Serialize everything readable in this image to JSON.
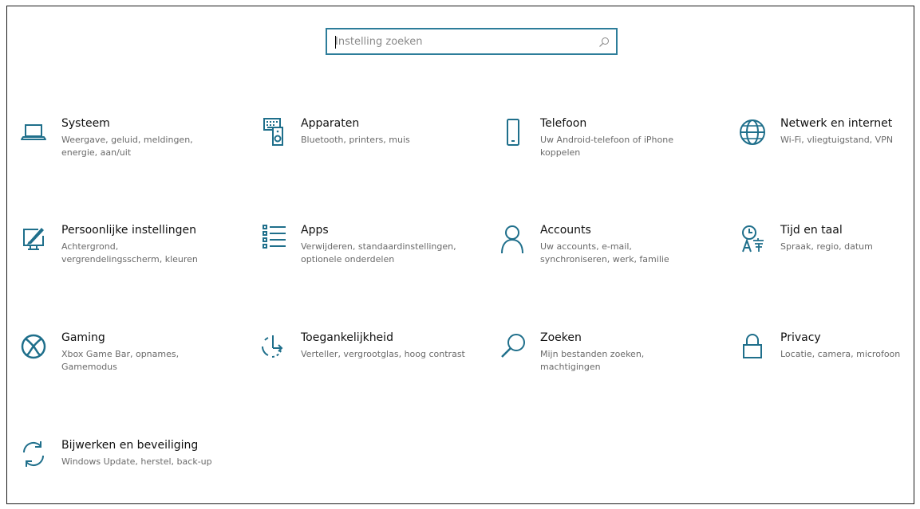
{
  "search": {
    "placeholder": "Instelling zoeken",
    "icon": "search-icon"
  },
  "accent_color": "#1f6f8b",
  "tiles": [
    {
      "title": "Systeem",
      "desc": "Weergave, geluid, meldingen, energie, aan/uit",
      "icon": "laptop-icon"
    },
    {
      "title": "Apparaten",
      "desc": "Bluetooth, printers, muis",
      "icon": "devices-icon"
    },
    {
      "title": "Telefoon",
      "desc": "Uw Android-telefoon of iPhone koppelen",
      "icon": "phone-icon"
    },
    {
      "title": "Netwerk en internet",
      "desc": "Wi-Fi, vliegtuigstand, VPN",
      "icon": "globe-icon"
    },
    {
      "title": "Persoonlijke instellingen",
      "desc": "Achtergrond, vergrendelingsscherm, kleuren",
      "icon": "personalization-icon"
    },
    {
      "title": "Apps",
      "desc": "Verwijderen, standaardinstellingen, optionele onderdelen",
      "icon": "apps-list-icon"
    },
    {
      "title": "Accounts",
      "desc": "Uw accounts, e-mail, synchroniseren, werk, familie",
      "icon": "person-icon"
    },
    {
      "title": "Tijd en taal",
      "desc": "Spraak, regio, datum",
      "icon": "time-language-icon"
    },
    {
      "title": "Gaming",
      "desc": "Xbox Game Bar, opnames, Gamemodus",
      "icon": "xbox-icon"
    },
    {
      "title": "Toegankelijkheid",
      "desc": "Verteller, vergrootglas, hoog contrast",
      "icon": "accessibility-icon"
    },
    {
      "title": "Zoeken",
      "desc": "Mijn bestanden zoeken, machtigingen",
      "icon": "magnifier-icon"
    },
    {
      "title": "Privacy",
      "desc": "Locatie, camera, microfoon",
      "icon": "lock-icon"
    },
    {
      "title": "Bijwerken en beveiliging",
      "desc": "Windows Update, herstel, back-up",
      "icon": "sync-icon"
    }
  ]
}
